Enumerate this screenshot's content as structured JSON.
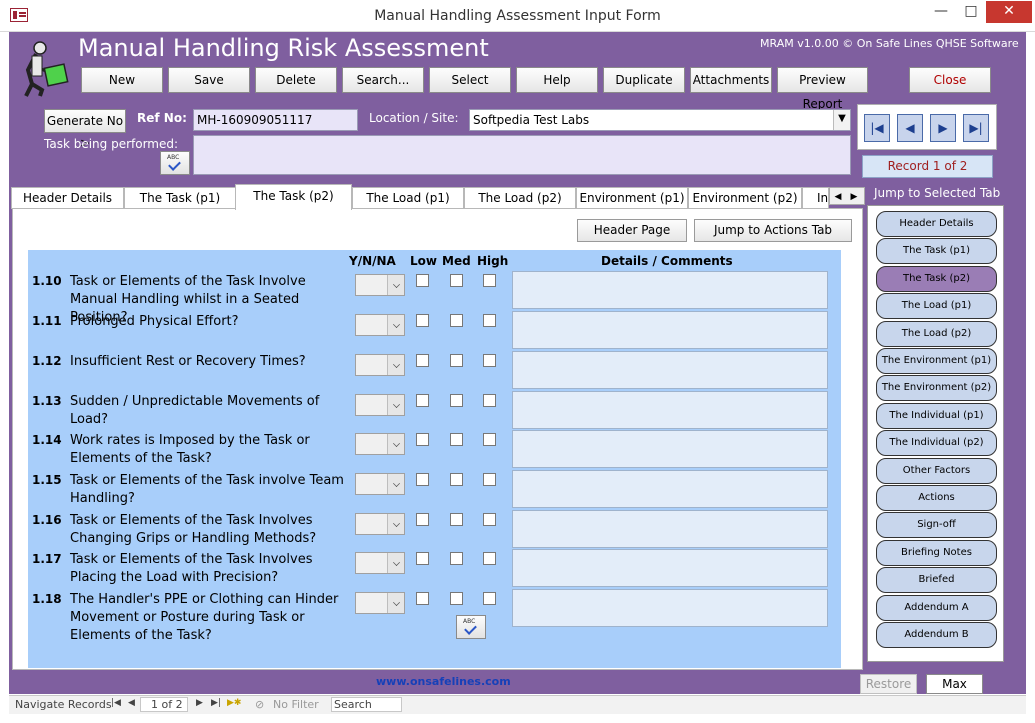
{
  "window": {
    "title": "Manual Handling Assessment Input Form",
    "min": "—",
    "max": "□",
    "close": "✕"
  },
  "header": {
    "app_title": "Manual Handling Risk Assessment",
    "version": "MRAM v1.0.00 © On Safe Lines QHSE Software"
  },
  "toolbar": {
    "new": "New",
    "save": "Save",
    "delete": "Delete",
    "search": "Search...",
    "select": "Select",
    "help": "Help",
    "duplicate": "Duplicate",
    "attachments": "Attachments",
    "preview_report": "Preview Report",
    "close": "Close"
  },
  "form": {
    "generate_no": "Generate No >",
    "ref_no_label": "Ref No:",
    "ref_no_value": "MH-160909051117",
    "location_label": "Location / Site:",
    "location_value": "Softpedia Test Labs",
    "task_label": "Task being performed:",
    "task_value": ""
  },
  "record": {
    "text": "Record 1 of 2"
  },
  "nav": {
    "first": "|◀",
    "prev": "◀",
    "next": "▶",
    "last": "▶|"
  },
  "tabs": [
    "Header Details",
    "The Task (p1)",
    "The Task (p2)",
    "The Load (p1)",
    "The Load (p2)",
    "Environment (p1)",
    "Environment (p2)",
    "In"
  ],
  "panel": {
    "header_page": "Header Page",
    "jump_actions": "Jump to Actions Tab"
  },
  "columns": {
    "yn": "Y/N/NA",
    "low": "Low",
    "med": "Med",
    "high": "High",
    "details": "Details / Comments"
  },
  "questions": [
    {
      "num": "1.10",
      "text": "Task or Elements of the Task Involve Manual Handling whilst in a Seated Position?"
    },
    {
      "num": "1.11",
      "text": "Prolonged Physical Effort?"
    },
    {
      "num": "1.12",
      "text": "Insufficient Rest or Recovery Times?"
    },
    {
      "num": "1.13",
      "text": "Sudden / Unpredictable Movements of Load?"
    },
    {
      "num": "1.14",
      "text": "Work rates is Imposed by the Task or Elements of the Task?"
    },
    {
      "num": "1.15",
      "text": "Task or Elements of the Task involve Team Handling?"
    },
    {
      "num": "1.16",
      "text": "Task or Elements of the Task Involves Changing Grips or Handling Methods?"
    },
    {
      "num": "1.17",
      "text": "Task or Elements of the Task Involves Placing the Load with Precision?"
    },
    {
      "num": "1.18",
      "text": "The Handler's PPE or Clothing can Hinder Movement or Posture during Task or Elements of the Task?"
    }
  ],
  "footer_url": "www.onsafelines.com",
  "jump": {
    "title": "Jump to Selected Tab",
    "items": [
      "Header Details",
      "The Task (p1)",
      "The Task (p2)",
      "The Load (p1)",
      "The Load (p2)",
      "The Environment (p1)",
      "The Environment (p2)",
      "The Individual (p1)",
      "The Individual (p2)",
      "Other Factors",
      "Actions",
      "Sign-off",
      "Briefing Notes",
      "Briefed",
      "Addendum A",
      "Addendum B"
    ],
    "active_index": 2
  },
  "size_buttons": {
    "restore": "Restore",
    "max": "Max"
  },
  "status": {
    "nav_records": "Navigate Records",
    "record_field": "1 of 2",
    "no_filter": "No Filter",
    "search": "Search"
  },
  "colors": {
    "form_bg": "#7f5f9f",
    "question_bg": "#a8cefa",
    "active_jump": "#9a7db5"
  }
}
